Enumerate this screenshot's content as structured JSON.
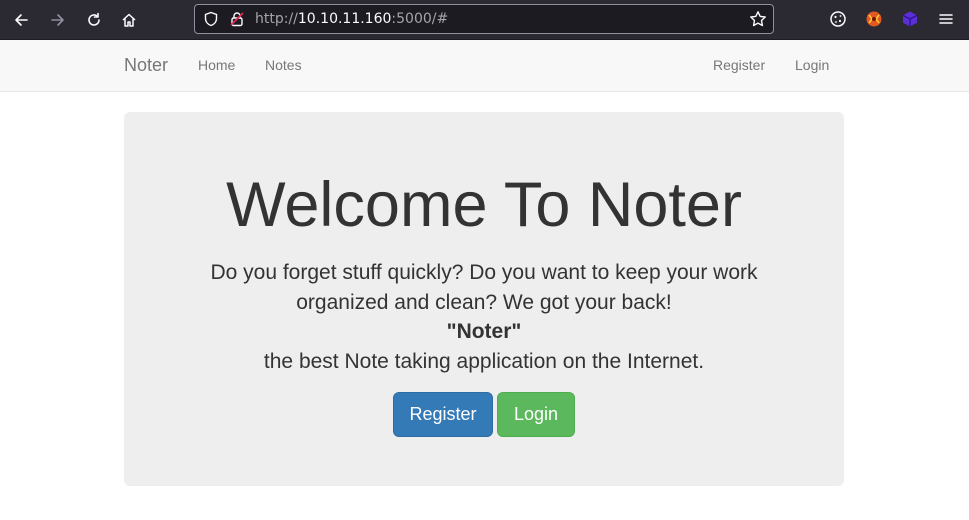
{
  "browser": {
    "url_scheme": "http://",
    "url_host": "10.10.11.160",
    "url_rest": ":5000/#",
    "icons": [
      "back-icon",
      "forward-icon",
      "reload-icon",
      "home-icon",
      "shield-icon",
      "insecure-lock-icon",
      "bookmark-star-icon",
      "cookie-extension-icon",
      "fox-extension-icon",
      "cube-extension-icon",
      "menu-icon"
    ]
  },
  "navbar": {
    "brand": "Noter",
    "links": [
      "Home",
      "Notes"
    ],
    "right_links": [
      "Register",
      "Login"
    ]
  },
  "jumbotron": {
    "title": "Welcome To Noter",
    "line1": "Do you forget stuff quickly? Do you want to keep your work",
    "line2": "organized and clean? We got your back!",
    "line3": "\"Noter\"",
    "line4": "the best Note taking application on the Internet.",
    "register_button": "Register",
    "login_button": "Login"
  },
  "colors": {
    "primary": "#337ab7",
    "success": "#5cb85c",
    "jumbotron_bg": "#eeeeee",
    "navbar_bg": "#f8f8f8",
    "chrome_bg": "#2b2a33"
  }
}
